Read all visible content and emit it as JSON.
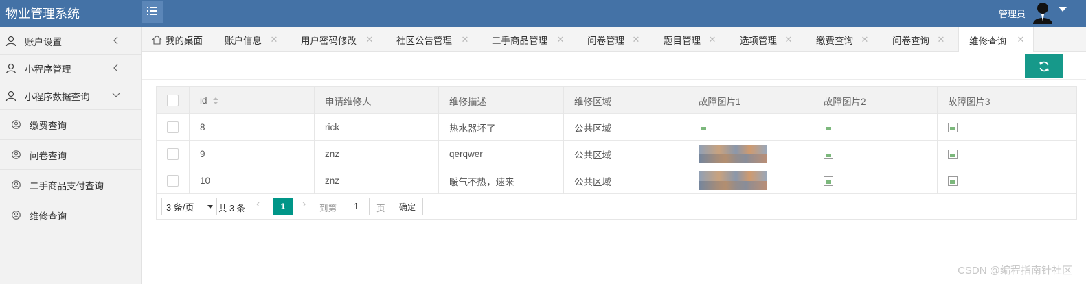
{
  "app": {
    "title": "物业管理系统"
  },
  "header": {
    "admin_label": "管理员"
  },
  "sidebar": {
    "groups": [
      {
        "label": "账户设置"
      },
      {
        "label": "小程序管理"
      },
      {
        "label": "小程序数据查询"
      }
    ],
    "subitems": [
      {
        "label": "缴费查询"
      },
      {
        "label": "问卷查询"
      },
      {
        "label": "二手商品支付查询"
      },
      {
        "label": "维修查询"
      }
    ]
  },
  "tabs": [
    {
      "label": "我的桌面"
    },
    {
      "label": "账户信息"
    },
    {
      "label": "用户密码修改"
    },
    {
      "label": "社区公告管理"
    },
    {
      "label": "二手商品管理"
    },
    {
      "label": "问卷管理"
    },
    {
      "label": "题目管理"
    },
    {
      "label": "选项管理"
    },
    {
      "label": "缴费查询"
    },
    {
      "label": "问卷查询"
    },
    {
      "label": "维修查询"
    }
  ],
  "table": {
    "columns": [
      "id",
      "申请维修人",
      "维修描述",
      "维修区域",
      "故障图片1",
      "故障图片2",
      "故障图片3"
    ],
    "rows": [
      {
        "id": "8",
        "applicant": "rick",
        "description": "热水器坏了",
        "area": "公共区域"
      },
      {
        "id": "9",
        "applicant": "znz",
        "description": "qerqwer",
        "area": "公共区域"
      },
      {
        "id": "10",
        "applicant": "znz",
        "description": "暖气不热，速来",
        "area": "公共区域"
      }
    ]
  },
  "pagination": {
    "page_size": "3 条/页",
    "total": "共 3 条",
    "current_page": "1",
    "goto_label": "到第",
    "goto_value": "1",
    "page_word": "页",
    "confirm": "确定"
  },
  "watermark": "CSDN @编程指南针社区",
  "colors": {
    "header": "#4472a6",
    "accent": "#009688",
    "refresh": "#16998a"
  }
}
